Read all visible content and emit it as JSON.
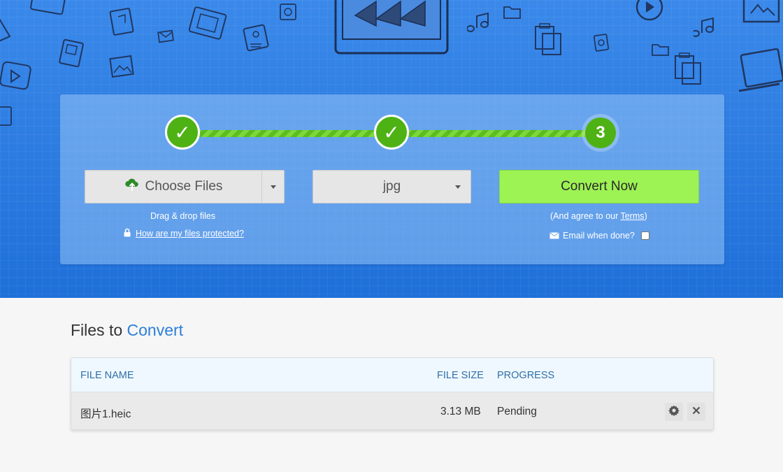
{
  "steps": {
    "step1_mark": "✓",
    "step2_mark": "✓",
    "step3_number": "3"
  },
  "actions": {
    "choose_files_label": "Choose Files",
    "format_value": "jpg",
    "convert_label": "Convert Now",
    "drag_drop_text": "Drag & drop files",
    "protected_link": "How are my files protected?",
    "agree_prefix": "(And agree to our ",
    "terms_link": "Terms",
    "agree_suffix": ")",
    "email_label": "Email when done?"
  },
  "files": {
    "title_prefix": "Files to ",
    "title_accent": "Convert",
    "columns": [
      "FILE NAME",
      "FILE SIZE",
      "PROGRESS"
    ],
    "rows": [
      {
        "name": "图片1.heic",
        "size": "3.13 MB",
        "progress": "Pending"
      }
    ]
  },
  "colors": {
    "hero_blue": "#2b7ee0",
    "step_green": "#4eb214",
    "convert_green": "#9df254",
    "accent_blue": "#2d7fd8"
  },
  "icons": [
    "cloud-upload-icon",
    "lock-icon",
    "envelope-icon",
    "gear-icon",
    "close-icon",
    "chevron-down-icon"
  ]
}
